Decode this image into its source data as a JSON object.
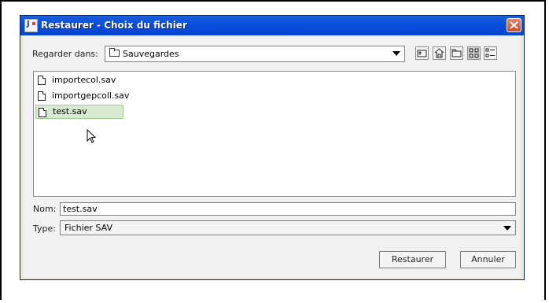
{
  "dialog": {
    "title": "Restaurer - Choix du fichier"
  },
  "lookin": {
    "label": "Regarder dans:",
    "value": "Sauvegardes"
  },
  "toolbar": {
    "icons": [
      "up-folder-icon",
      "home-icon",
      "new-folder-icon",
      "list-view-icon",
      "details-view-icon"
    ]
  },
  "files": [
    {
      "name": "importecol.sav"
    },
    {
      "name": "importgepcoll.sav"
    },
    {
      "name": "test.sav",
      "selected": true
    }
  ],
  "name_field": {
    "label": "Nom:",
    "value": "test.sav"
  },
  "type_field": {
    "label": "Type:",
    "value": "Fichier SAV"
  },
  "buttons": {
    "restore": "Restaurer",
    "cancel": "Annuler"
  },
  "colors": {
    "titlebar": "#0a4ee0",
    "selection": "#d7ead1"
  }
}
